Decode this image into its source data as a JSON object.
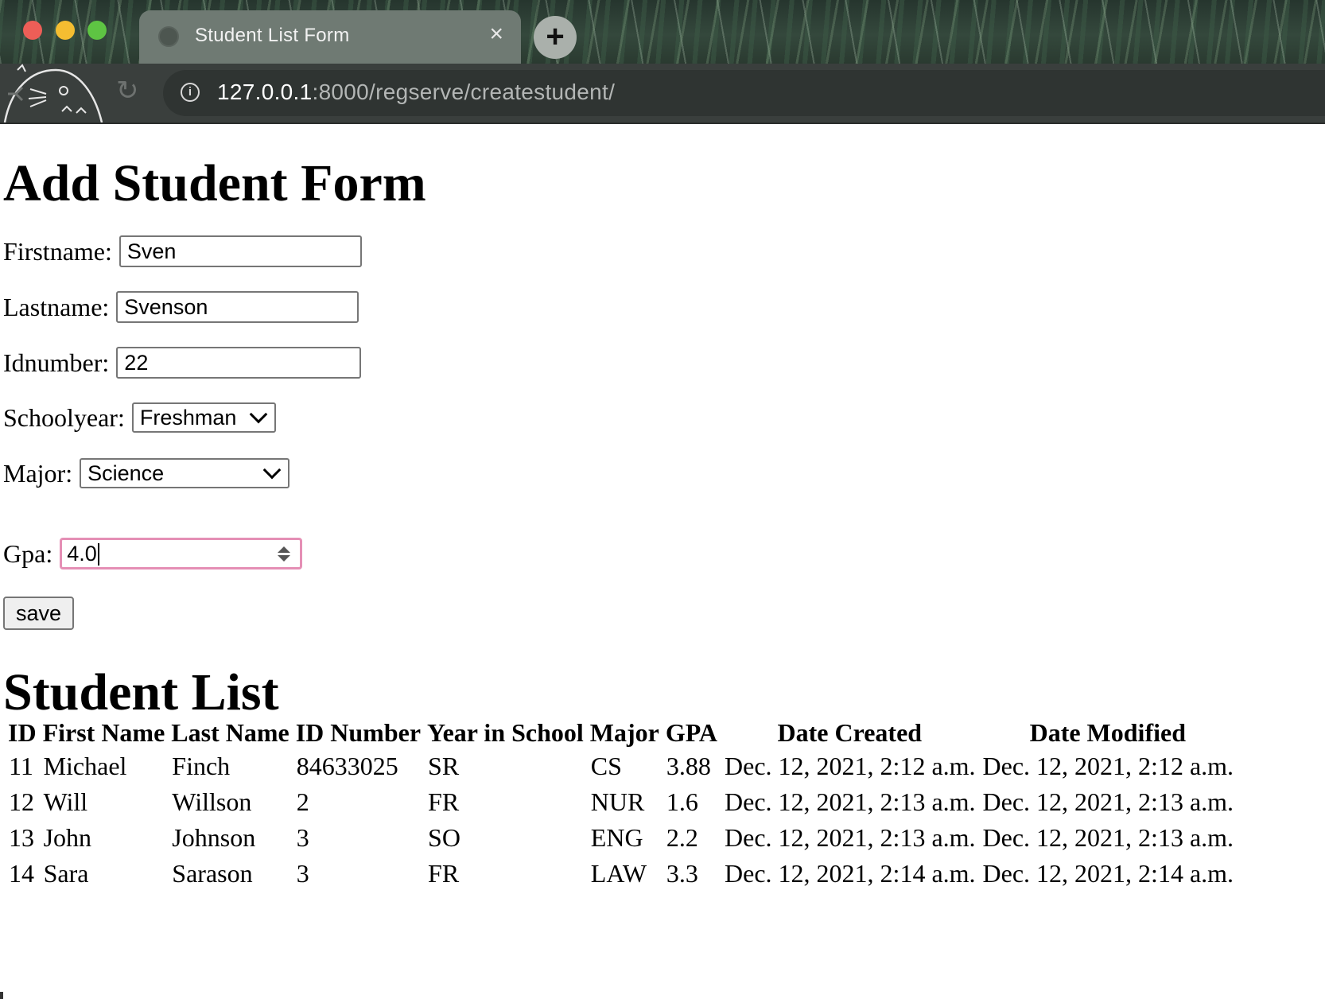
{
  "browser": {
    "tab_title": "Student List Form",
    "tab_close": "×",
    "new_tab": "+",
    "url_host": "127.0.0.1",
    "url_path": ":8000/regserve/createstudent/"
  },
  "form": {
    "heading": "Add Student Form",
    "firstname_label": "Firstname:",
    "firstname_value": "Sven",
    "lastname_label": "Lastname:",
    "lastname_value": "Svenson",
    "idnumber_label": "Idnumber:",
    "idnumber_value": "22",
    "schoolyear_label": "Schoolyear:",
    "schoolyear_value": "Freshman",
    "major_label": "Major:",
    "major_value": "Science",
    "gpa_label": "Gpa:",
    "gpa_value": "4.0",
    "save_label": "save"
  },
  "list": {
    "heading": "Student List",
    "columns": [
      "ID",
      "First Name",
      "Last Name",
      "ID Number",
      "Year in School",
      "Major",
      "GPA",
      "Date Created",
      "Date Modified"
    ],
    "rows": [
      [
        "11",
        "Michael",
        "Finch",
        "84633025",
        "SR",
        "CS",
        "3.88",
        "Dec. 12, 2021, 2:12 a.m.",
        "Dec. 12, 2021, 2:12 a.m."
      ],
      [
        "12",
        "Will",
        "Willson",
        "2",
        "FR",
        "NUR",
        "1.6",
        "Dec. 12, 2021, 2:13 a.m.",
        "Dec. 12, 2021, 2:13 a.m."
      ],
      [
        "13",
        "John",
        "Johnson",
        "3",
        "SO",
        "ENG",
        "2.2",
        "Dec. 12, 2021, 2:13 a.m.",
        "Dec. 12, 2021, 2:13 a.m."
      ],
      [
        "14",
        "Sara",
        "Sarason",
        "3",
        "FR",
        "LAW",
        "3.3",
        "Dec. 12, 2021, 2:14 a.m.",
        "Dec. 12, 2021, 2:14 a.m."
      ]
    ]
  },
  "colors": {
    "focus_ring": "#e58fb5",
    "toolbar": "#3a3f3d"
  },
  "icons": [
    "globe-icon",
    "close-icon",
    "plus-icon",
    "reload-icon",
    "info-icon",
    "chevron-down-icon",
    "spinner-icon"
  ]
}
